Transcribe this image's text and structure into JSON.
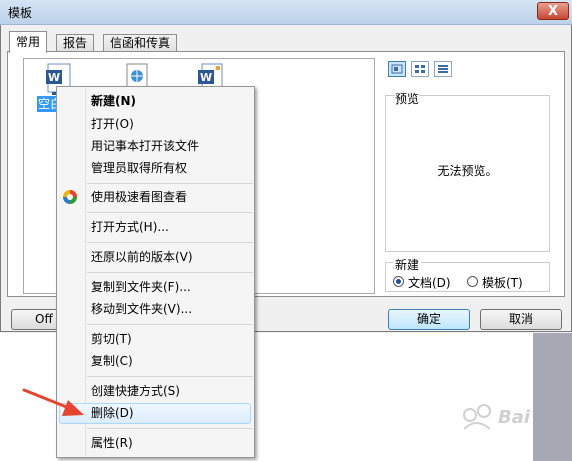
{
  "window": {
    "title": "模板",
    "close_label": "X"
  },
  "tabs": [
    {
      "label": "常用",
      "active": true
    },
    {
      "label": "报告",
      "active": false
    },
    {
      "label": "信函和传真",
      "active": false
    }
  ],
  "files": {
    "selected_label": "空白"
  },
  "preview": {
    "label": "预览",
    "empty_text": "无法预览。"
  },
  "new_group": {
    "label": "新建",
    "options": [
      {
        "label": "文档(D)",
        "checked": true
      },
      {
        "label": "模板(T)",
        "checked": false
      }
    ]
  },
  "buttons": {
    "office_label": "Off",
    "ok_label": "确定",
    "cancel_label": "取消"
  },
  "context_menu": {
    "items": [
      {
        "label": "新建(N)",
        "bold": true
      },
      {
        "label": "打开(O)"
      },
      {
        "label": "用记事本打开该文件"
      },
      {
        "label": "管理员取得所有权"
      },
      {
        "label": "使用极速看图查看"
      },
      {
        "label": "打开方式(H)..."
      },
      {
        "label": "还原以前的版本(V)"
      },
      {
        "label": "复制到文件夹(F)..."
      },
      {
        "label": "移动到文件夹(V)..."
      },
      {
        "label": "剪切(T)"
      },
      {
        "label": "复制(C)"
      },
      {
        "label": "创建快捷方式(S)"
      },
      {
        "label": "删除(D)",
        "hovered": true
      },
      {
        "label": "属性(R)"
      }
    ]
  },
  "colors": {
    "accent": "#3399ff",
    "hover_bg": "#dcecfc",
    "arrow": "#e8432e"
  }
}
